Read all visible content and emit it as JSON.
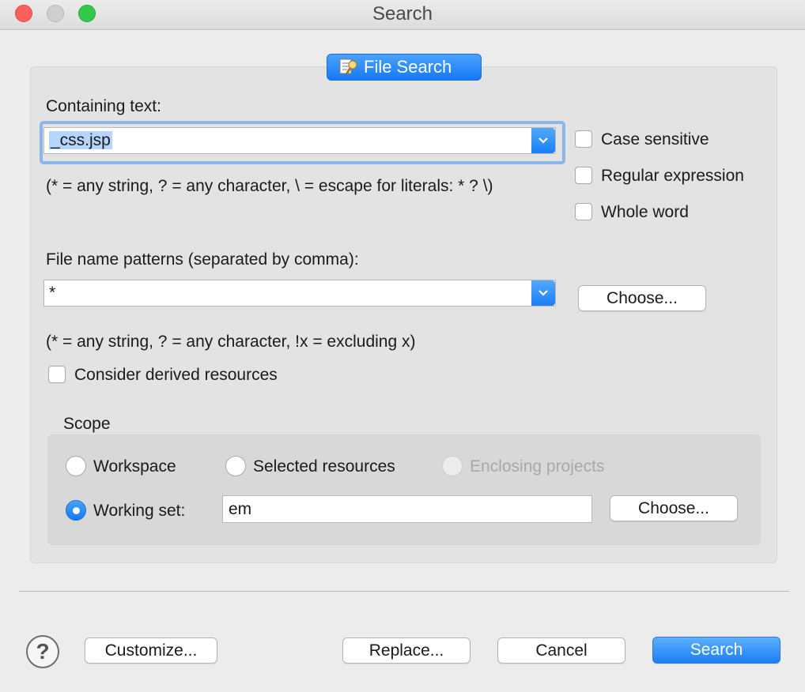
{
  "window": {
    "title": "Search"
  },
  "tab": {
    "label": "File Search"
  },
  "containing_text": {
    "label": "Containing text:",
    "value": "_css.jsp",
    "hint": "(* = any string, ? = any character, \\ = escape for literals: * ? \\)"
  },
  "options": {
    "case_sensitive": "Case sensitive",
    "regular_expression": "Regular expression",
    "whole_word": "Whole word"
  },
  "file_patterns": {
    "label": "File name patterns (separated by comma):",
    "value": "*",
    "choose": "Choose...",
    "hint": "(* = any string, ? = any character, !x = excluding x)"
  },
  "derived": {
    "label": "Consider derived resources"
  },
  "scope": {
    "title": "Scope",
    "workspace": "Workspace",
    "selected_resources": "Selected resources",
    "enclosing_projects": "Enclosing projects",
    "working_set_label": "Working set:",
    "working_set_value": "em",
    "choose": "Choose..."
  },
  "footer": {
    "help": "?",
    "customize": "Customize...",
    "replace": "Replace...",
    "cancel": "Cancel",
    "search": "Search"
  }
}
